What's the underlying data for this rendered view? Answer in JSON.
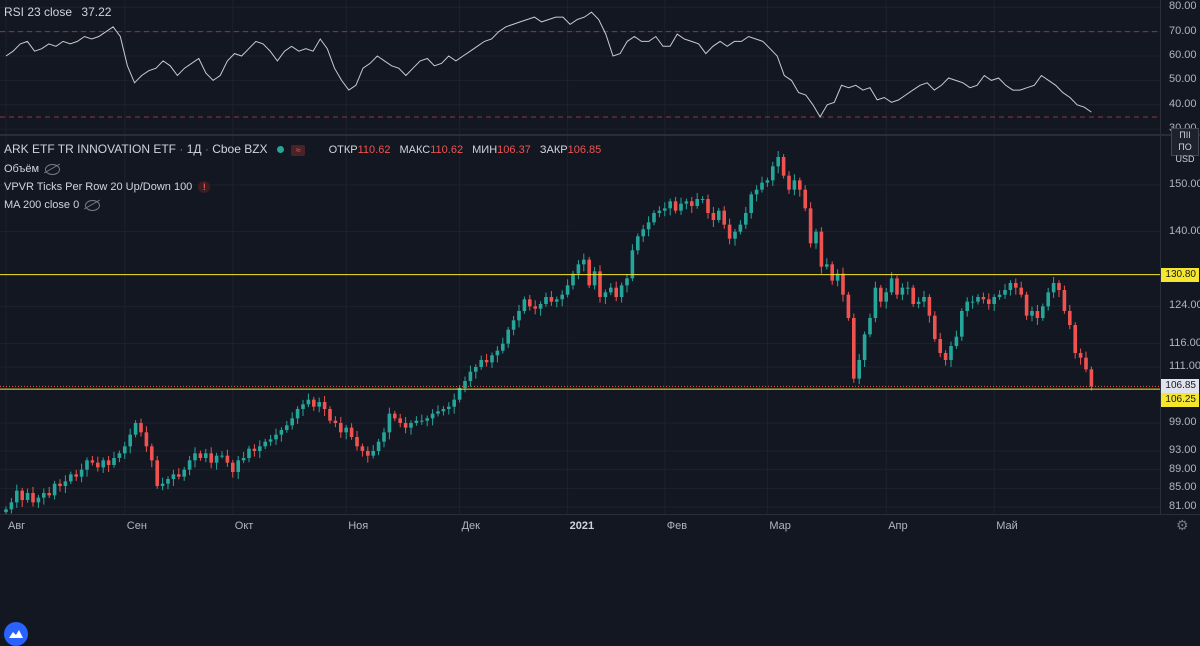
{
  "rsi": {
    "title": "RSI 23 close",
    "value": "37.22",
    "axis_labels": [
      "80.00",
      "70.00",
      "60.00",
      "50.00",
      "40.00",
      "30.00"
    ],
    "axis_values": [
      80,
      70,
      60,
      50,
      40,
      30
    ],
    "ylim": [
      28,
      83
    ],
    "upper_band": 70,
    "lower_band": 35,
    "series": [
      60,
      62,
      65,
      66,
      62,
      63,
      65,
      64,
      66,
      65,
      66,
      68,
      67,
      68,
      70,
      72,
      68,
      56,
      49,
      52,
      54,
      55,
      58,
      56,
      52,
      55,
      57,
      59,
      53,
      50,
      52,
      58,
      61,
      60,
      63,
      66,
      65,
      62,
      58,
      62,
      64,
      62,
      63,
      62,
      67,
      63,
      55,
      50,
      46,
      48,
      55,
      57,
      60,
      58,
      56,
      55,
      52,
      55,
      58,
      59,
      56,
      57,
      60,
      58,
      60,
      62,
      64,
      66,
      67,
      70,
      72,
      73,
      74,
      75,
      76,
      74,
      75,
      76,
      76,
      73,
      75,
      76,
      78,
      75,
      69,
      60,
      61,
      66,
      68,
      66,
      66,
      68,
      64,
      64,
      69,
      67,
      66,
      65,
      61,
      64,
      66,
      64,
      66,
      66,
      68,
      67,
      66,
      63,
      60,
      52,
      50,
      45,
      44,
      40,
      35,
      40,
      41,
      48,
      47,
      48,
      46,
      47,
      42,
      43,
      41,
      42,
      44,
      46,
      48,
      49,
      46,
      48,
      51,
      50,
      49,
      47,
      48,
      52,
      50,
      51,
      48,
      46,
      46,
      47,
      48,
      52,
      50,
      48,
      45,
      43,
      40,
      39,
      37
    ]
  },
  "symbol": {
    "name": "ARK ETF TR INNOVATION ETF",
    "interval": "1Д",
    "exchange": "Cboe BZX",
    "open_label": "ОТКР",
    "open": "110.62",
    "high_label": "МАКС",
    "high": "110.62",
    "low_label": "МИН",
    "low": "106.37",
    "close_label": "ЗАКР",
    "close": "106.85",
    "badge": "≈"
  },
  "indicators": {
    "volume": "Объём",
    "vpvr": "VPVR Ticks Per Row 20 Up/Down 100",
    "vpvr_error": "!",
    "ma": "MA 200 close 0"
  },
  "price_axis": {
    "currency_top": "ΠΙΙ ΠΟ",
    "currency": "USD",
    "labels": [
      "150.00",
      "140.00",
      "124.00",
      "116.00",
      "111.00",
      "99.00",
      "93.00",
      "89.00",
      "85.00",
      "81.00"
    ],
    "values": [
      150,
      140,
      124,
      116,
      111,
      99,
      93,
      89,
      85,
      81
    ],
    "ylim": [
      79.5,
      160.5
    ],
    "level_high": "130.80",
    "level_high_value": 130.8,
    "level_low": "106.25",
    "level_low_value": 106.25,
    "last_price": "106.85",
    "last_price_value": 106.85
  },
  "time_axis": {
    "labels": [
      "Авг",
      "Сен",
      "Окт",
      "Ноя",
      "Дек",
      "2021",
      "Фев",
      "Мар",
      "Апр",
      "Май"
    ],
    "label_index": [
      0,
      22,
      42,
      63,
      84,
      104,
      122,
      141,
      163,
      183
    ]
  },
  "colors": {
    "up": "#26a69a",
    "down": "#ef5350",
    "level": "#f5e72d",
    "rsi_line": "#c8cad0",
    "band": "#8b3a3a",
    "bg": "#131722"
  },
  "chart_data": {
    "type": "candlestick",
    "ylim": [
      79.5,
      160.5
    ],
    "closes": [
      80.5,
      82,
      84.5,
      82.5,
      84,
      82,
      83,
      84,
      83.5,
      86,
      85.5,
      86.5,
      88,
      87.5,
      89,
      91,
      90.5,
      89.5,
      91,
      90,
      91.5,
      92.5,
      94,
      96.5,
      99,
      97,
      94,
      91,
      85.5,
      86,
      87,
      88,
      87.5,
      89,
      91,
      92.5,
      91.5,
      92.5,
      90.5,
      92,
      92,
      90.5,
      88.5,
      91,
      91.5,
      93.5,
      93,
      94,
      95,
      95.5,
      96.5,
      97.5,
      98.5,
      100,
      102,
      103,
      104,
      102.5,
      103.5,
      102,
      99.5,
      99,
      97,
      98,
      96,
      94,
      93,
      92,
      93,
      95,
      97,
      101,
      100,
      99,
      98,
      99,
      99.5,
      99.5,
      100,
      101,
      101.5,
      102,
      102.5,
      104,
      106.5,
      108,
      110,
      111,
      112.5,
      112,
      113.5,
      114.5,
      116,
      119,
      121,
      123,
      125.5,
      124,
      123.5,
      124.5,
      126,
      125,
      125.5,
      126.5,
      128.5,
      131,
      133,
      134,
      128.5,
      131.5,
      126,
      127,
      128,
      126,
      128.5,
      130,
      136,
      139,
      140.5,
      142,
      144,
      144.5,
      145,
      146.5,
      144.5,
      146,
      146.5,
      145.5,
      147,
      147,
      144,
      142.5,
      144.5,
      141.5,
      138.5,
      140,
      141.5,
      144,
      148,
      149,
      150.5,
      151,
      154,
      156,
      152,
      149,
      151,
      149,
      145,
      137.5,
      140,
      132.5,
      133,
      129.5,
      131,
      126.5,
      121.5,
      108.5,
      112.5,
      118,
      121.5,
      128,
      125,
      127,
      130,
      126.5,
      128,
      128,
      124.5,
      125,
      126,
      122,
      117,
      114,
      112.5,
      115.5,
      117.5,
      123,
      125,
      125,
      126,
      125.5,
      124.5,
      126,
      126.5,
      127.5,
      129,
      128,
      126.5,
      122,
      123,
      121.5,
      124,
      127,
      129,
      127.5,
      123,
      120,
      114,
      113,
      110.5,
      106.85
    ]
  }
}
